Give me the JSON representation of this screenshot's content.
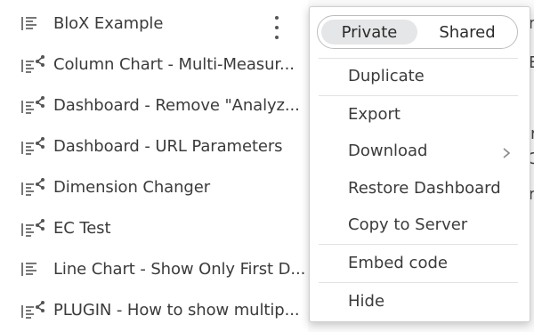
{
  "dashboard_list": {
    "items": [
      {
        "label": "BloX Example",
        "icon": "widget-list-icon"
      },
      {
        "label": "Column Chart - Multi-Measur...",
        "icon": "shared-list-icon"
      },
      {
        "label": "Dashboard - Remove \"Analyz...",
        "icon": "shared-list-icon"
      },
      {
        "label": "Dashboard - URL Parameters",
        "icon": "shared-list-icon"
      },
      {
        "label": "Dimension Changer",
        "icon": "shared-list-icon"
      },
      {
        "label": "EC Test",
        "icon": "shared-list-icon"
      },
      {
        "label": "Line Chart - Show Only First D...",
        "icon": "widget-list-icon"
      },
      {
        "label": "PLUGIN - How to show multip...",
        "icon": "shared-list-icon"
      }
    ]
  },
  "context_menu": {
    "toggle": {
      "private_label": "Private",
      "shared_label": "Shared",
      "selected": "Private"
    },
    "items": {
      "duplicate": "Duplicate",
      "export": "Export",
      "download": "Download",
      "restore": "Restore Dashboard",
      "copy_to_server": "Copy to Server",
      "embed_code": "Embed code",
      "hide": "Hide"
    }
  },
  "colors": {
    "text": "#3b3b3b",
    "toggle_active": "#e4e6e8",
    "menu_border": "#cfcfcf"
  }
}
